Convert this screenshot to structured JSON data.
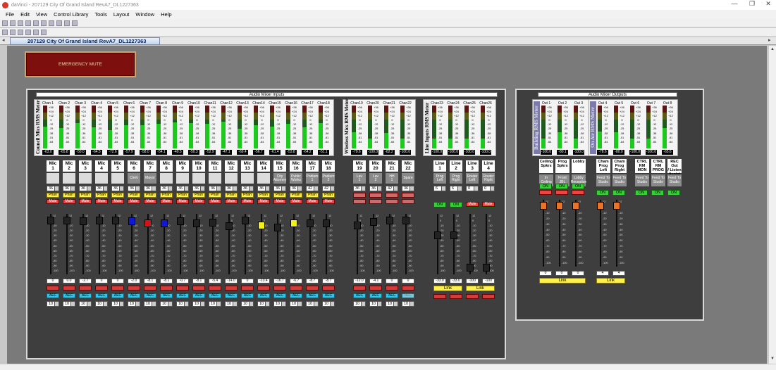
{
  "window": {
    "title": "daVinci - 207129 City Of Grand Island RevA7_DL1227363",
    "min": "—",
    "max": "❐",
    "close": "✕"
  },
  "menu": [
    "File",
    "Edit",
    "View",
    "Control Library",
    "Tools",
    "Layout",
    "Window",
    "Help"
  ],
  "doc_tab": "207129 City Of Grand Island RevA7_DL1227363",
  "emergency_mute": "EMERGENCY MUTE",
  "meter_scale": [
    "+36",
    "+24",
    "+12",
    "0",
    "-12",
    "-25",
    "-38",
    "-51",
    "-64"
  ],
  "fader_scale": [
    "12",
    "0",
    "-10",
    "-20",
    "-30",
    "-40",
    "-50",
    "-60",
    "-70",
    "-80",
    "-90",
    "-100"
  ],
  "colors": {
    "red": "#ee4444",
    "yellow": "#fff04c",
    "green": "#35d035",
    "cyan": "#2ec6e8",
    "orange": "#e8742a"
  },
  "inputs": {
    "title": "Audio Mixer Inputs",
    "groups": [
      {
        "label": "Council Mics RMS Meter",
        "meter_names": [
          "Chan 1",
          "Chan 2",
          "Chan 3",
          "Chan 4",
          "Chan 5",
          "Chan 6",
          "Chan 7",
          "Chan 8",
          "Chan 9",
          "Chan10",
          "Chan11",
          "Chan12",
          "Chan13",
          "Chan14",
          "Chan15",
          "Chan16",
          "Chan17",
          "Chan18"
        ],
        "meter_values": [
          "-63.0",
          "-65.8",
          "-50.0",
          "-64.5",
          "-72.6",
          "-57.9",
          "-58.0",
          "-54.1",
          "-49.5",
          "-50.3",
          "-52.9",
          "-47.1",
          "-69.4",
          "-56.7",
          "-61.4",
          "-53.8",
          "-64.2",
          "-51.1"
        ]
      },
      {
        "label": "Wireless Mics RMS Meter",
        "meter_names": [
          "Chan19",
          "Chan20",
          "Chan21",
          "Chan22"
        ],
        "meter_values": [
          "-79.6",
          "-100.0",
          "-82.2",
          "-100.0"
        ]
      },
      {
        "label": "Line Inputs RMS Meter",
        "meter_names": [
          "Chan23",
          "Chan24",
          "Chan25",
          "Chan26"
        ],
        "meter_values": [
          "-100.0",
          "-100.0",
          "-100.0",
          "-100.0"
        ]
      }
    ],
    "channels": [
      {
        "name": "Mic\n1",
        "loc": "",
        "gain": "36",
        "level": "0",
        "knob": "#222",
        "pos": 0.05
      },
      {
        "name": "Mic\n2",
        "loc": "",
        "gain": "36",
        "level": "0.0",
        "knob": "#222",
        "pos": 0.05
      },
      {
        "name": "Mic\n3",
        "loc": "",
        "gain": "36",
        "level": "-2.7",
        "knob": "#222",
        "pos": 0.07
      },
      {
        "name": "Mic\n4",
        "loc": "",
        "gain": "36",
        "level": "0",
        "knob": "#222",
        "pos": 0.05
      },
      {
        "name": "Mic\n5",
        "loc": "",
        "gain": "36",
        "level": "0",
        "knob": "#222",
        "pos": 0.05
      },
      {
        "name": "Mic\n6",
        "loc": "Clerk",
        "gain": "36",
        "level": "-2.0",
        "knob": "#1018d8",
        "pos": 0.07
      },
      {
        "name": "Mic\n7",
        "loc": "Mayor",
        "gain": "36",
        "level": "-8.1",
        "knob": "#d81010",
        "pos": 0.11
      },
      {
        "name": "Mic\n8",
        "loc": "",
        "gain": "36",
        "level": "-8.1",
        "knob": "#1018d8",
        "pos": 0.11
      },
      {
        "name": "Mic\n9",
        "loc": "",
        "gain": "36",
        "level": "-0.7",
        "knob": "#222",
        "pos": 0.06
      },
      {
        "name": "Mic\n10",
        "loc": "",
        "gain": "36",
        "level": "-8.1",
        "knob": "#222",
        "pos": 0.11
      },
      {
        "name": "Mic\n11",
        "loc": "",
        "gain": "36",
        "level": "-5.4",
        "knob": "#222",
        "pos": 0.09
      },
      {
        "name": "Mic\n12",
        "loc": "",
        "gain": "36",
        "level": "-14.0",
        "knob": "#222",
        "pos": 0.16
      },
      {
        "name": "Mic\n13",
        "loc": "",
        "gain": "36",
        "level": "0",
        "knob": "#222",
        "pos": 0.05
      },
      {
        "name": "Mic\n14",
        "loc": "",
        "gain": "36",
        "level": "-13.4",
        "knob": "#f4f01a",
        "pos": 0.15
      },
      {
        "name": "Mic\n15",
        "loc": "City\nAttorney",
        "gain": "36",
        "level": "-16.7",
        "knob": "#222",
        "pos": 0.18
      },
      {
        "name": "Mic\n16",
        "loc": "Public\nWorks",
        "gain": "36",
        "level": "-6.7",
        "knob": "#f4f01a",
        "pos": 0.1
      },
      {
        "name": "Mic\n17",
        "loc": "Podium\n1",
        "gain": "42",
        "level": "-8.7",
        "knob": "#222",
        "pos": 0.11
      },
      {
        "name": "Mic\n18",
        "loc": "Podium\n2",
        "gain": "42",
        "level": "-8.7",
        "knob": "#222",
        "pos": 0.11
      },
      {
        "name": "Mic\n19",
        "loc": "Lav\n1",
        "gain": "36",
        "level": "-12.0",
        "knob": "#222",
        "pos": 0.14
      },
      {
        "name": "Mic\n20",
        "loc": "Lav\n2",
        "gain": "36",
        "level": "-4.1",
        "knob": "#222",
        "pos": 0.08
      },
      {
        "name": "Mic\n21",
        "loc": "HH\n1",
        "gain": "42",
        "level": "0",
        "knob": "#222",
        "pos": 0.05
      },
      {
        "name": "Mic\n22",
        "loc": "Spare",
        "gain": "36",
        "level": "0",
        "knob": "#222",
        "pos": 0.05
      },
      {
        "name": "Line\n1",
        "loc": "Prog\nLeft",
        "gain": "6",
        "level": "-33.0",
        "knob": "#222",
        "pos": 0.33
      },
      {
        "name": "Line\n2",
        "loc": "Prog\nRight",
        "gain": "6",
        "level": "-33.0",
        "knob": "#222",
        "pos": 0.33
      },
      {
        "name": "Line\n3",
        "loc": "Router\nLeft",
        "gain": "0",
        "level": "-100",
        "knob": "#222",
        "pos": 0.95
      },
      {
        "name": "Line\n4",
        "loc": "Router\nRight",
        "gain": "0",
        "level": "-100",
        "knob": "#222",
        "pos": 0.95
      }
    ],
    "phan_label": "Phan",
    "mute_label": "Mute",
    "on_label": "ON",
    "aec_label": "AEC",
    "bottom_value": "10",
    "link_label": "Link"
  },
  "outputs": {
    "title": "Audio Mixer Outputs",
    "groups": [
      {
        "label": "Building RMS Meter",
        "meter_names": [
          "Out 1",
          "Out 2",
          "Out 3"
        ],
        "meter_values": [
          "-100.0",
          "-80.1",
          "-100.0"
        ]
      },
      {
        "label": "On Air RMS Meter",
        "meter_names": [
          "Out 4",
          "Out 5",
          "Out 6",
          "Out 7",
          "Out 8"
        ],
        "meter_values": [
          "-78.6",
          "-80.0",
          "-100.0",
          "-100.0",
          "-65.6"
        ]
      }
    ],
    "channels": [
      {
        "name": "Ceiling\nSpkrs",
        "feed": "In\nCeiling",
        "level": "0",
        "mute": true
      },
      {
        "name": "Prog\nSpkrs",
        "feed": "Front\nJBL",
        "level": "0",
        "mute": true
      },
      {
        "name": "Lobby",
        "feed": "Lobby\nReception",
        "level": "0",
        "mute": true
      },
      {
        "name": "Cham\nProg\nLeft",
        "feed": "Feed To\nStudio",
        "level": "4",
        "mute": false
      },
      {
        "name": "Cham\nProg\nRight",
        "feed": "Feed To\nStudio",
        "level": "4",
        "mute": false
      },
      {
        "name": "CTRL\nRM\nMON",
        "feed": "Feed To\nStudio",
        "level": "",
        "mute": false
      },
      {
        "name": "CTRL\nRM\nPROG",
        "feed": "Feed To\nStudio",
        "level": "",
        "mute": false
      },
      {
        "name": "REC Out\n/ Listen\nAssist",
        "feed": "Feed To\nStudio",
        "level": "",
        "mute": false
      }
    ]
  }
}
